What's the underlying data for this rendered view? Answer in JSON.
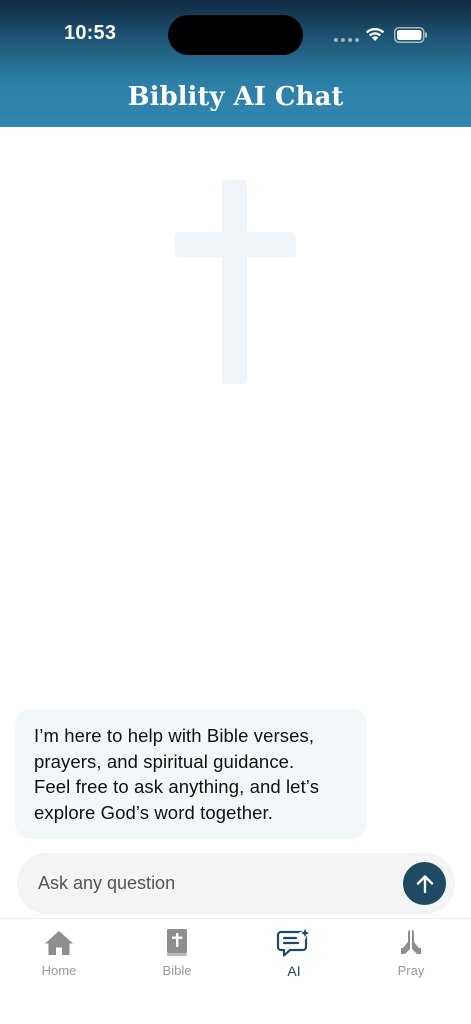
{
  "status_bar": {
    "time": "10:53"
  },
  "header": {
    "title": "Biblity AI Chat"
  },
  "chat": {
    "messages": [
      {
        "role": "assistant",
        "lines": [
          "I’m here to help with Bible verses,",
          "prayers, and spiritual guidance.",
          "Feel free to ask anything, and let’s",
          "explore God’s word together."
        ]
      }
    ]
  },
  "input": {
    "placeholder": "Ask any question",
    "value": ""
  },
  "tabs": [
    {
      "label": "Home",
      "icon": "home-icon",
      "active": false
    },
    {
      "label": "Bible",
      "icon": "bible-icon",
      "active": false
    },
    {
      "label": "AI",
      "icon": "ai-chat-icon",
      "active": true
    },
    {
      "label": "Pray",
      "icon": "praying-hands-icon",
      "active": false
    }
  ],
  "colors": {
    "accent": "#1e4a64",
    "header": "#3287af",
    "bubble": "#f2f8fa",
    "cross_watermark": "#eef4f7",
    "inactive_tab": "#9a9a9a"
  }
}
